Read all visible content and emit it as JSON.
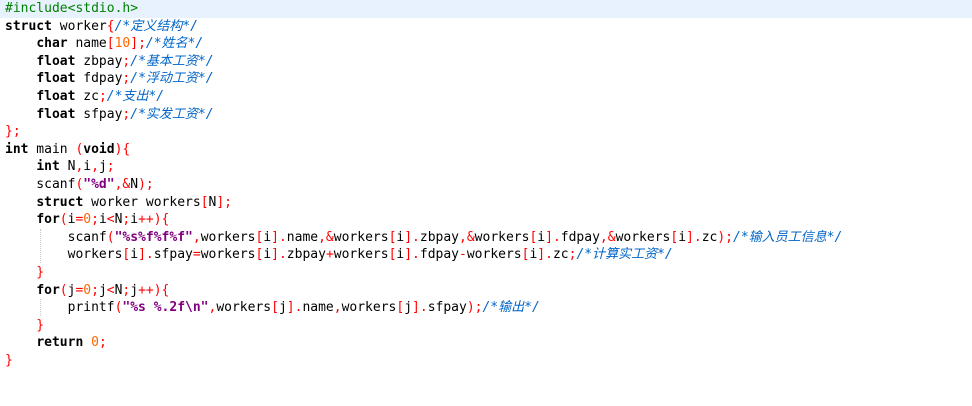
{
  "editor": {
    "current_line": 1,
    "lines": [
      [
        {
          "t": "#include<stdio.h>",
          "c": "pp"
        }
      ],
      [
        {
          "t": "struct",
          "c": "kw"
        },
        {
          "t": " worker",
          "c": "id"
        },
        {
          "t": "{",
          "c": "br"
        },
        {
          "t": "/*定义结构*/",
          "c": "cm"
        }
      ],
      [
        {
          "t": "    ",
          "c": "id"
        },
        {
          "t": "char",
          "c": "kw"
        },
        {
          "t": " name",
          "c": "id"
        },
        {
          "t": "[",
          "c": "op"
        },
        {
          "t": "10",
          "c": "num"
        },
        {
          "t": "];",
          "c": "op"
        },
        {
          "t": "/*姓名*/",
          "c": "cm"
        }
      ],
      [
        {
          "t": "    ",
          "c": "id"
        },
        {
          "t": "float",
          "c": "kw"
        },
        {
          "t": " zbpay",
          "c": "id"
        },
        {
          "t": ";",
          "c": "op"
        },
        {
          "t": "/*基本工资*/",
          "c": "cm"
        }
      ],
      [
        {
          "t": "    ",
          "c": "id"
        },
        {
          "t": "float",
          "c": "kw"
        },
        {
          "t": " fdpay",
          "c": "id"
        },
        {
          "t": ";",
          "c": "op"
        },
        {
          "t": "/*浮动工资*/",
          "c": "cm"
        }
      ],
      [
        {
          "t": "    ",
          "c": "id"
        },
        {
          "t": "float",
          "c": "kw"
        },
        {
          "t": " zc",
          "c": "id"
        },
        {
          "t": ";",
          "c": "op"
        },
        {
          "t": "/*支出*/",
          "c": "cm"
        }
      ],
      [
        {
          "t": "    ",
          "c": "id"
        },
        {
          "t": "float",
          "c": "kw"
        },
        {
          "t": " sfpay",
          "c": "id"
        },
        {
          "t": ";",
          "c": "op"
        },
        {
          "t": "/*实发工资*/",
          "c": "cm"
        }
      ],
      [
        {
          "t": "};",
          "c": "br"
        }
      ],
      [
        {
          "t": "int",
          "c": "kw"
        },
        {
          "t": " main ",
          "c": "id"
        },
        {
          "t": "(",
          "c": "op"
        },
        {
          "t": "void",
          "c": "kw"
        },
        {
          "t": "){",
          "c": "op"
        }
      ],
      [
        {
          "t": "    ",
          "c": "id"
        },
        {
          "t": "int",
          "c": "kw"
        },
        {
          "t": " N",
          "c": "id"
        },
        {
          "t": ",",
          "c": "op"
        },
        {
          "t": "i",
          "c": "id"
        },
        {
          "t": ",",
          "c": "op"
        },
        {
          "t": "j",
          "c": "id"
        },
        {
          "t": ";",
          "c": "op"
        }
      ],
      [
        {
          "t": "    scanf",
          "c": "id"
        },
        {
          "t": "(",
          "c": "op"
        },
        {
          "t": "\"%d\"",
          "c": "str"
        },
        {
          "t": ",&",
          "c": "op"
        },
        {
          "t": "N",
          "c": "id"
        },
        {
          "t": ");",
          "c": "op"
        }
      ],
      [
        {
          "t": "    ",
          "c": "id"
        },
        {
          "t": "struct",
          "c": "kw"
        },
        {
          "t": " worker workers",
          "c": "id"
        },
        {
          "t": "[",
          "c": "op"
        },
        {
          "t": "N",
          "c": "id"
        },
        {
          "t": "];",
          "c": "op"
        }
      ],
      [
        {
          "t": "    ",
          "c": "id"
        },
        {
          "t": "for",
          "c": "kw"
        },
        {
          "t": "(",
          "c": "op"
        },
        {
          "t": "i",
          "c": "id"
        },
        {
          "t": "=",
          "c": "op"
        },
        {
          "t": "0",
          "c": "num"
        },
        {
          "t": ";",
          "c": "op"
        },
        {
          "t": "i",
          "c": "id"
        },
        {
          "t": "<",
          "c": "op"
        },
        {
          "t": "N",
          "c": "id"
        },
        {
          "t": ";",
          "c": "op"
        },
        {
          "t": "i",
          "c": "id"
        },
        {
          "t": "++){",
          "c": "op"
        }
      ],
      [
        {
          "t": "        scanf",
          "c": "id"
        },
        {
          "t": "(",
          "c": "op"
        },
        {
          "t": "\"%s%f%f%f\"",
          "c": "str"
        },
        {
          "t": ",",
          "c": "op"
        },
        {
          "t": "workers",
          "c": "id"
        },
        {
          "t": "[",
          "c": "op"
        },
        {
          "t": "i",
          "c": "id"
        },
        {
          "t": "].",
          "c": "op"
        },
        {
          "t": "name",
          "c": "id"
        },
        {
          "t": ",&",
          "c": "op"
        },
        {
          "t": "workers",
          "c": "id"
        },
        {
          "t": "[",
          "c": "op"
        },
        {
          "t": "i",
          "c": "id"
        },
        {
          "t": "].",
          "c": "op"
        },
        {
          "t": "zbpay",
          "c": "id"
        },
        {
          "t": ",&",
          "c": "op"
        },
        {
          "t": "workers",
          "c": "id"
        },
        {
          "t": "[",
          "c": "op"
        },
        {
          "t": "i",
          "c": "id"
        },
        {
          "t": "].",
          "c": "op"
        },
        {
          "t": "fdpay",
          "c": "id"
        },
        {
          "t": ",&",
          "c": "op"
        },
        {
          "t": "workers",
          "c": "id"
        },
        {
          "t": "[",
          "c": "op"
        },
        {
          "t": "i",
          "c": "id"
        },
        {
          "t": "].",
          "c": "op"
        },
        {
          "t": "zc",
          "c": "id"
        },
        {
          "t": ");",
          "c": "op"
        },
        {
          "t": "/*输入员工信息*/",
          "c": "cm"
        }
      ],
      [
        {
          "t": "        workers",
          "c": "id"
        },
        {
          "t": "[",
          "c": "op"
        },
        {
          "t": "i",
          "c": "id"
        },
        {
          "t": "].",
          "c": "op"
        },
        {
          "t": "sfpay",
          "c": "id"
        },
        {
          "t": "=",
          "c": "op"
        },
        {
          "t": "workers",
          "c": "id"
        },
        {
          "t": "[",
          "c": "op"
        },
        {
          "t": "i",
          "c": "id"
        },
        {
          "t": "].",
          "c": "op"
        },
        {
          "t": "zbpay",
          "c": "id"
        },
        {
          "t": "+",
          "c": "op"
        },
        {
          "t": "workers",
          "c": "id"
        },
        {
          "t": "[",
          "c": "op"
        },
        {
          "t": "i",
          "c": "id"
        },
        {
          "t": "].",
          "c": "op"
        },
        {
          "t": "fdpay",
          "c": "id"
        },
        {
          "t": "-",
          "c": "op"
        },
        {
          "t": "workers",
          "c": "id"
        },
        {
          "t": "[",
          "c": "op"
        },
        {
          "t": "i",
          "c": "id"
        },
        {
          "t": "].",
          "c": "op"
        },
        {
          "t": "zc",
          "c": "id"
        },
        {
          "t": ";",
          "c": "op"
        },
        {
          "t": "/*计算实工资*/",
          "c": "cm"
        }
      ],
      [
        {
          "t": "    }",
          "c": "br"
        }
      ],
      [
        {
          "t": "    ",
          "c": "id"
        },
        {
          "t": "for",
          "c": "kw"
        },
        {
          "t": "(",
          "c": "op"
        },
        {
          "t": "j",
          "c": "id"
        },
        {
          "t": "=",
          "c": "op"
        },
        {
          "t": "0",
          "c": "num"
        },
        {
          "t": ";",
          "c": "op"
        },
        {
          "t": "j",
          "c": "id"
        },
        {
          "t": "<",
          "c": "op"
        },
        {
          "t": "N",
          "c": "id"
        },
        {
          "t": ";",
          "c": "op"
        },
        {
          "t": "j",
          "c": "id"
        },
        {
          "t": "++){",
          "c": "op"
        }
      ],
      [
        {
          "t": "        printf",
          "c": "id"
        },
        {
          "t": "(",
          "c": "op"
        },
        {
          "t": "\"%s %.2f\\n\"",
          "c": "str"
        },
        {
          "t": ",",
          "c": "op"
        },
        {
          "t": "workers",
          "c": "id"
        },
        {
          "t": "[",
          "c": "op"
        },
        {
          "t": "j",
          "c": "id"
        },
        {
          "t": "].",
          "c": "op"
        },
        {
          "t": "name",
          "c": "id"
        },
        {
          "t": ",",
          "c": "op"
        },
        {
          "t": "workers",
          "c": "id"
        },
        {
          "t": "[",
          "c": "op"
        },
        {
          "t": "j",
          "c": "id"
        },
        {
          "t": "].",
          "c": "op"
        },
        {
          "t": "sfpay",
          "c": "id"
        },
        {
          "t": ");",
          "c": "op"
        },
        {
          "t": "/*输出*/",
          "c": "cm"
        }
      ],
      [
        {
          "t": "    }",
          "c": "br"
        }
      ],
      [
        {
          "t": "    ",
          "c": "id"
        },
        {
          "t": "return",
          "c": "kw"
        },
        {
          "t": " ",
          "c": "id"
        },
        {
          "t": "0",
          "c": "num"
        },
        {
          "t": ";",
          "c": "op"
        }
      ],
      [
        {
          "t": "}",
          "c": "br"
        }
      ]
    ]
  }
}
